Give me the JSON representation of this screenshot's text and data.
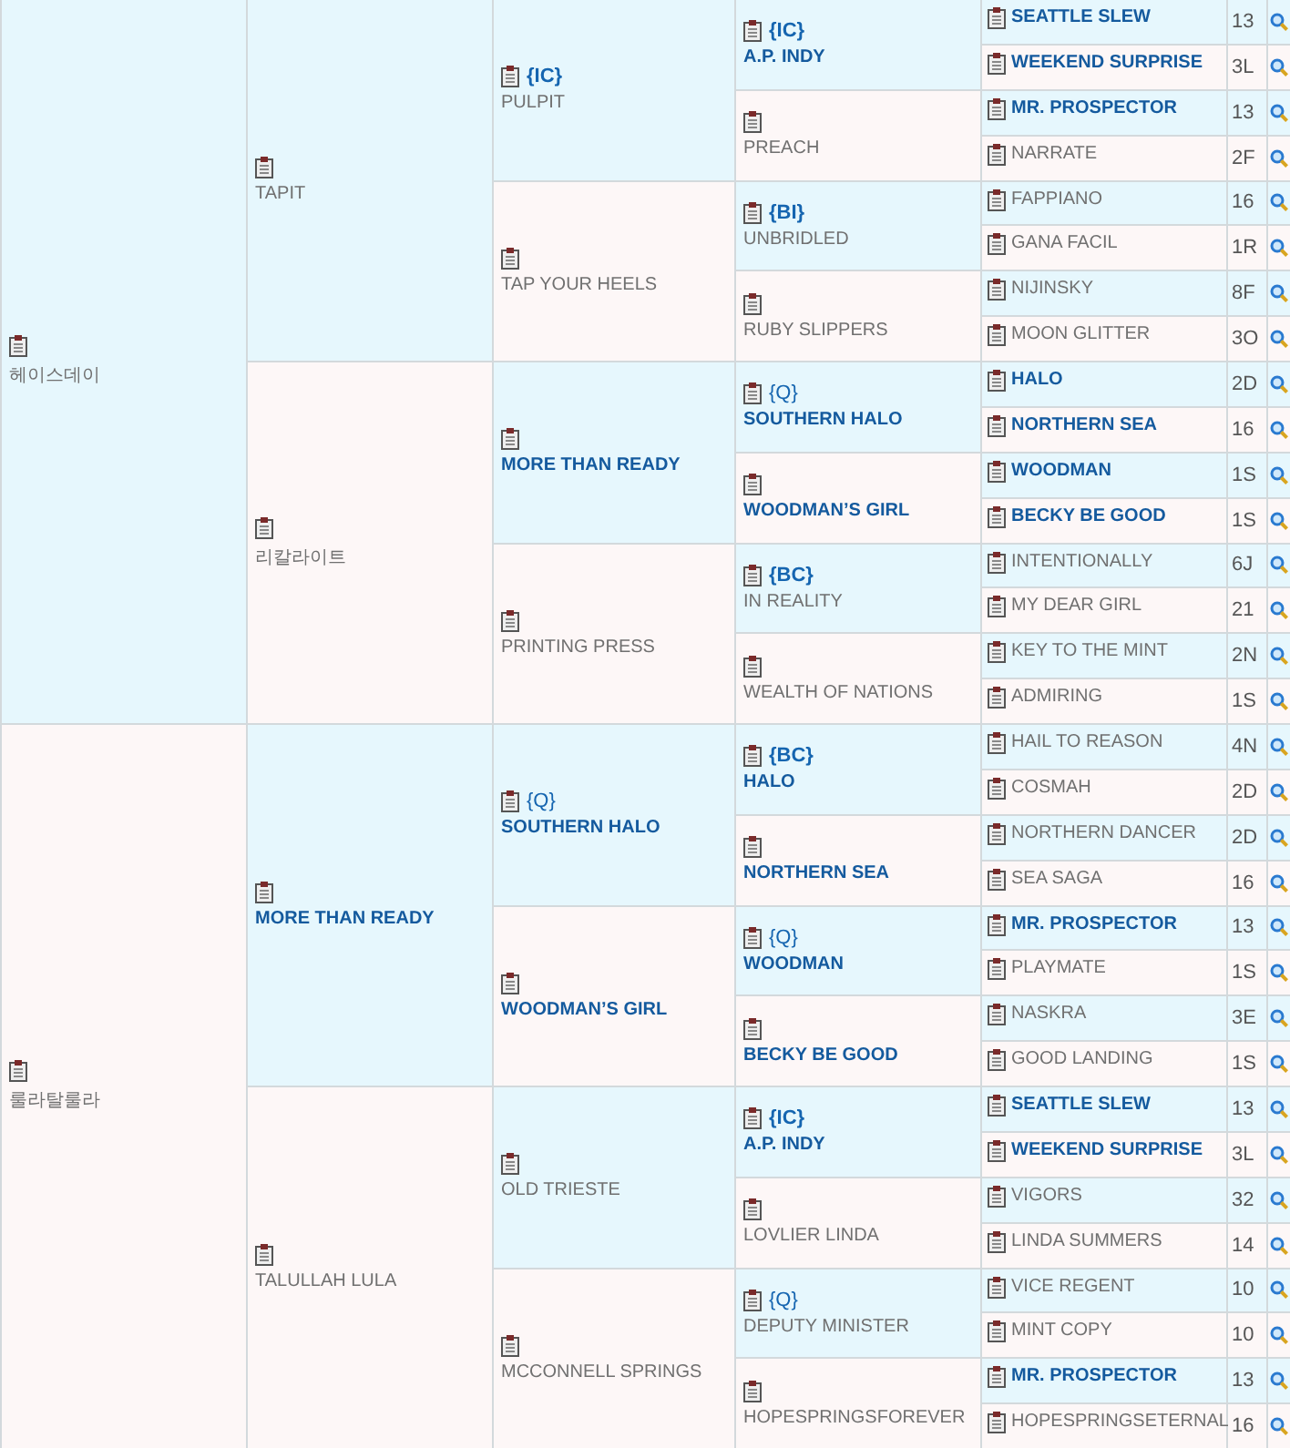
{
  "pedigree": [
    {
      "name": "헤이스데이",
      "notable": false,
      "children": [
        {
          "name": "TAPIT",
          "notable": false,
          "children": [
            {
              "name": "PULPIT",
              "notable": false,
              "tag": {
                "text": "{IC}",
                "bold": true
              },
              "children": [
                {
                  "name": "A.P. INDY",
                  "notable": true,
                  "tag": {
                    "text": "{IC}",
                    "bold": true
                  },
                  "children": [
                    {
                      "name": "SEATTLE SLEW",
                      "notable": true,
                      "code": "13"
                    },
                    {
                      "name": "WEEKEND SURPRISE",
                      "notable": true,
                      "code": "3L"
                    }
                  ]
                },
                {
                  "name": "PREACH",
                  "notable": false,
                  "children": [
                    {
                      "name": "MR. PROSPECTOR",
                      "notable": true,
                      "code": "13"
                    },
                    {
                      "name": "NARRATE",
                      "notable": false,
                      "code": "2F"
                    }
                  ]
                }
              ]
            },
            {
              "name": "TAP YOUR HEELS",
              "notable": false,
              "children": [
                {
                  "name": "UNBRIDLED",
                  "notable": false,
                  "tag": {
                    "text": "{BI}",
                    "bold": true
                  },
                  "children": [
                    {
                      "name": "FAPPIANO",
                      "notable": false,
                      "code": "16"
                    },
                    {
                      "name": "GANA FACIL",
                      "notable": false,
                      "code": "1R"
                    }
                  ]
                },
                {
                  "name": "RUBY SLIPPERS",
                  "notable": false,
                  "children": [
                    {
                      "name": "NIJINSKY",
                      "notable": false,
                      "code": "8F"
                    },
                    {
                      "name": "MOON GLITTER",
                      "notable": false,
                      "code": "3O"
                    }
                  ]
                }
              ]
            }
          ]
        },
        {
          "name": "리칼라이트",
          "notable": false,
          "children": [
            {
              "name": "MORE THAN READY",
              "notable": true,
              "children": [
                {
                  "name": "SOUTHERN HALO",
                  "notable": true,
                  "tag": {
                    "text": "{Q}",
                    "bold": false
                  },
                  "children": [
                    {
                      "name": "HALO",
                      "notable": true,
                      "code": "2D"
                    },
                    {
                      "name": "NORTHERN SEA",
                      "notable": true,
                      "code": "16"
                    }
                  ]
                },
                {
                  "name": "WOODMAN’S GIRL",
                  "notable": true,
                  "children": [
                    {
                      "name": "WOODMAN",
                      "notable": true,
                      "code": "1S"
                    },
                    {
                      "name": "BECKY BE GOOD",
                      "notable": true,
                      "code": "1S"
                    }
                  ]
                }
              ]
            },
            {
              "name": "PRINTING PRESS",
              "notable": false,
              "children": [
                {
                  "name": "IN REALITY",
                  "notable": false,
                  "tag": {
                    "text": "{BC}",
                    "bold": true
                  },
                  "children": [
                    {
                      "name": "INTENTIONALLY",
                      "notable": false,
                      "code": "6J"
                    },
                    {
                      "name": "MY DEAR GIRL",
                      "notable": false,
                      "code": "21"
                    }
                  ]
                },
                {
                  "name": "WEALTH OF NATIONS",
                  "notable": false,
                  "children": [
                    {
                      "name": "KEY TO THE MINT",
                      "notable": false,
                      "code": "2N"
                    },
                    {
                      "name": "ADMIRING",
                      "notable": false,
                      "code": "1S"
                    }
                  ]
                }
              ]
            }
          ]
        }
      ]
    },
    {
      "name": "룰라탈룰라",
      "notable": false,
      "children": [
        {
          "name": "MORE THAN READY",
          "notable": true,
          "children": [
            {
              "name": "SOUTHERN HALO",
              "notable": true,
              "tag": {
                "text": "{Q}",
                "bold": false
              },
              "children": [
                {
                  "name": "HALO",
                  "notable": true,
                  "tag": {
                    "text": "{BC}",
                    "bold": true
                  },
                  "children": [
                    {
                      "name": "HAIL TO REASON",
                      "notable": false,
                      "code": "4N"
                    },
                    {
                      "name": "COSMAH",
                      "notable": false,
                      "code": "2D"
                    }
                  ]
                },
                {
                  "name": "NORTHERN SEA",
                  "notable": true,
                  "children": [
                    {
                      "name": "NORTHERN DANCER",
                      "notable": false,
                      "code": "2D"
                    },
                    {
                      "name": "SEA SAGA",
                      "notable": false,
                      "code": "16"
                    }
                  ]
                }
              ]
            },
            {
              "name": "WOODMAN’S GIRL",
              "notable": true,
              "children": [
                {
                  "name": "WOODMAN",
                  "notable": true,
                  "tag": {
                    "text": "{Q}",
                    "bold": false
                  },
                  "children": [
                    {
                      "name": "MR. PROSPECTOR",
                      "notable": true,
                      "code": "13"
                    },
                    {
                      "name": "PLAYMATE",
                      "notable": false,
                      "code": "1S"
                    }
                  ]
                },
                {
                  "name": "BECKY BE GOOD",
                  "notable": true,
                  "children": [
                    {
                      "name": "NASKRA",
                      "notable": false,
                      "code": "3E"
                    },
                    {
                      "name": "GOOD LANDING",
                      "notable": false,
                      "code": "1S"
                    }
                  ]
                }
              ]
            }
          ]
        },
        {
          "name": "TALULLAH LULA",
          "notable": false,
          "children": [
            {
              "name": "OLD TRIESTE",
              "notable": false,
              "children": [
                {
                  "name": "A.P. INDY",
                  "notable": true,
                  "tag": {
                    "text": "{IC}",
                    "bold": true
                  },
                  "children": [
                    {
                      "name": "SEATTLE SLEW",
                      "notable": true,
                      "code": "13"
                    },
                    {
                      "name": "WEEKEND SURPRISE",
                      "notable": true,
                      "code": "3L"
                    }
                  ]
                },
                {
                  "name": "LOVLIER LINDA",
                  "notable": false,
                  "children": [
                    {
                      "name": "VIGORS",
                      "notable": false,
                      "code": "32"
                    },
                    {
                      "name": "LINDA SUMMERS",
                      "notable": false,
                      "code": "14"
                    }
                  ]
                }
              ]
            },
            {
              "name": "MCCONNELL SPRINGS",
              "notable": false,
              "children": [
                {
                  "name": "DEPUTY MINISTER",
                  "notable": false,
                  "tag": {
                    "text": "{Q}",
                    "bold": false
                  },
                  "children": [
                    {
                      "name": "VICE REGENT",
                      "notable": false,
                      "code": "10"
                    },
                    {
                      "name": "MINT COPY",
                      "notable": false,
                      "code": "10"
                    }
                  ]
                },
                {
                  "name": "HOPESPRINGSFOREVER",
                  "notable": false,
                  "children": [
                    {
                      "name": "MR. PROSPECTOR",
                      "notable": true,
                      "code": "13"
                    },
                    {
                      "name": "HOPESPRINGSETERNAL",
                      "notable": false,
                      "code": "16"
                    }
                  ]
                }
              ]
            }
          ]
        }
      ]
    }
  ]
}
